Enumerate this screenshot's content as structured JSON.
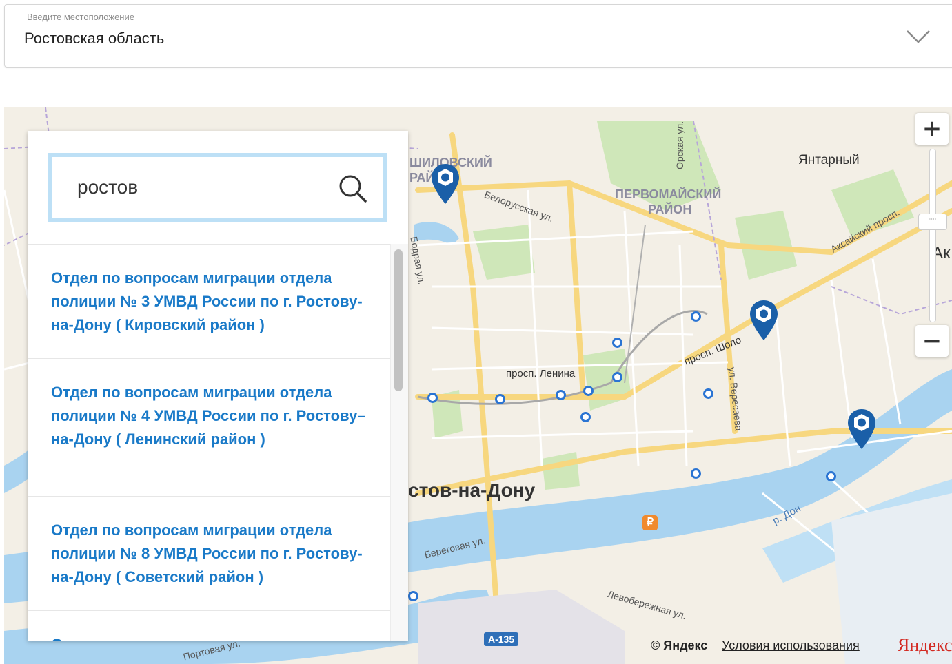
{
  "location": {
    "label": "Введите местоположение",
    "value": "Ростовская область"
  },
  "search": {
    "value": "ростов"
  },
  "results": [
    "Отдел по вопросам миграции отдела полиции № 3 УМВД России по г. Ростову-на-Дону ( Кировский район )",
    "Отдел по вопросам миграции отдела полиции № 4 УМВД России по г. Ростову–на-Дону ( Ленинский район )",
    "Отдел по вопросам миграции отдела полиции № 8 УМВД России по г. Ростову-на-Дону ( Советский район )",
    "Отдел по вопросам миграции отдела"
  ],
  "map": {
    "labels": {
      "district1": "ШИЛОВСКИЙ",
      "district1b": "РАЙ",
      "district2": "ПЕРВОМАЙСКИЙ",
      "district2b": "РАЙОН",
      "yantarny": "Янтарный",
      "orskaya": "Орская ул.",
      "belorusskaya": "Белорусская ул.",
      "aksaysky": "Аксайский просп.",
      "ak": "Ак",
      "bodraya": "Бодрая ул.",
      "lenina": "просп. Ленина",
      "sholo": "просп. Шоло",
      "veresaeva": "ул. Вересаева",
      "city": "стов-на-Дону",
      "beregovaya": "Береговая ул.",
      "don": "р. Дон",
      "levoberezhnaya": "Левобережная ул.",
      "portovaya": "Портовая ул.",
      "highway": "А-135",
      "rub": "₽"
    },
    "zoom_in": "+",
    "zoom_out": "−",
    "zoom_handle": "::::",
    "copyright": "© Яндекс",
    "terms": "Условия использования",
    "logo": "Яндекс"
  },
  "colors": {
    "pin": "#1a5fa8",
    "link": "#1a7ac8",
    "focus_border": "#bde0f6",
    "water": "#a9d3f0",
    "park": "#cfe7b9",
    "road": "#f7d77f"
  },
  "icons": {
    "search": "magnifier-icon",
    "chevron": "chevron-down-icon",
    "pin": "map-pin-icon"
  }
}
